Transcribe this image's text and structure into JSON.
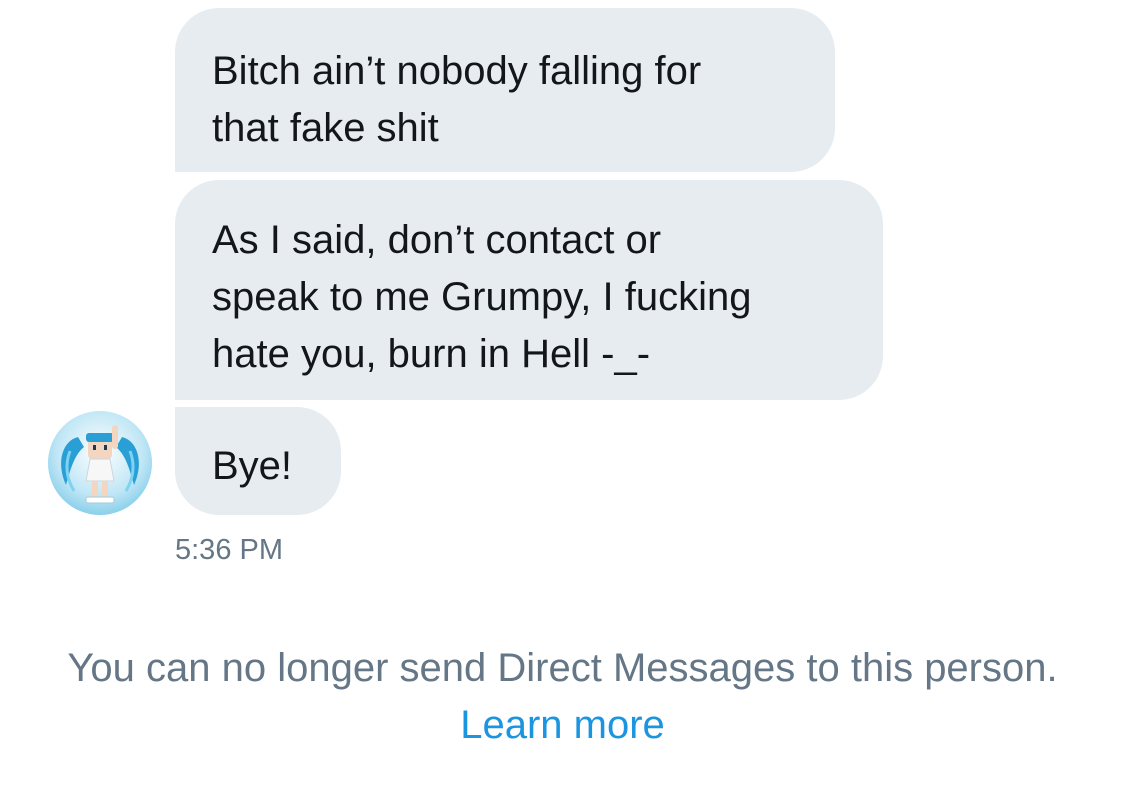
{
  "conversation": {
    "messages": [
      {
        "text": "Bitch ain’t nobody falling for\nthat fake shit"
      },
      {
        "text": "As I said, don’t contact or\nspeak to me Grumpy, I fucking\nhate you, burn in Hell -_-"
      },
      {
        "text": "Bye!"
      }
    ],
    "timestamp": "5:36 PM"
  },
  "footer": {
    "notice_text": "You can no longer send Direct Messages to this person.",
    "learn_more_label": "Learn more"
  },
  "avatar": {
    "icon": "anime-character-avatar"
  },
  "colors": {
    "bubble_bg": "#e6ecf0",
    "text": "#14171a",
    "muted": "#657786",
    "link": "#1b95e0"
  }
}
